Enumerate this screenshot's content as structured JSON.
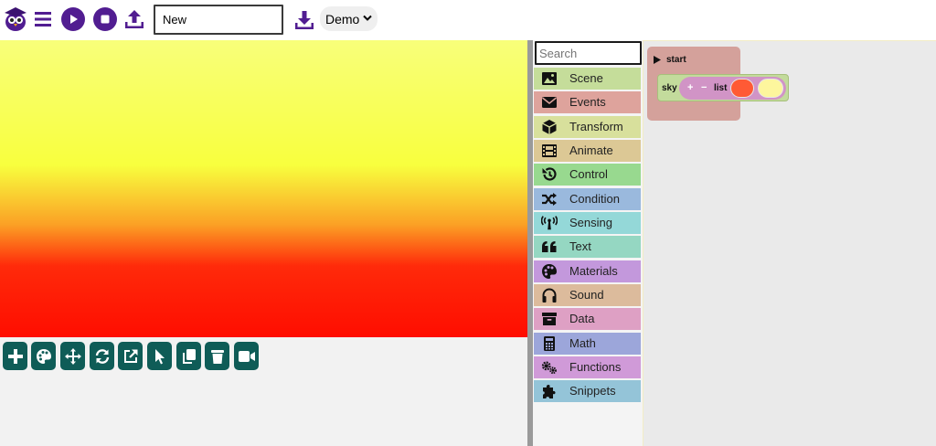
{
  "toolbar": {
    "project_name_value": "New",
    "demo_select_value": "Demo"
  },
  "colors": {
    "accent_purple": "#511d91",
    "tool_button": "#0f5c57",
    "sky_top": "#fdf69d",
    "sky_bottom": "#ff5a35"
  },
  "stage_tools": [
    {
      "icon": "plus-icon"
    },
    {
      "icon": "palette-icon"
    },
    {
      "icon": "move-icon"
    },
    {
      "icon": "rotate-icon"
    },
    {
      "icon": "external-link-icon"
    },
    {
      "icon": "pointer-icon"
    },
    {
      "icon": "copy-icon"
    },
    {
      "icon": "trash-icon"
    },
    {
      "icon": "video-camera-icon"
    }
  ],
  "toolbox": {
    "search_placeholder": "Search",
    "categories": [
      {
        "label": "Scene",
        "icon": "image-icon",
        "color": "#c5dd9a"
      },
      {
        "label": "Events",
        "icon": "envelope-icon",
        "color": "#dea39c"
      },
      {
        "label": "Transform",
        "icon": "cube-icon",
        "color": "#d8e09c"
      },
      {
        "label": "Animate",
        "icon": "film-icon",
        "color": "#dcc895"
      },
      {
        "label": "Control",
        "icon": "history-icon",
        "color": "#98d98f"
      },
      {
        "label": "Condition",
        "icon": "shuffle-icon",
        "color": "#9ab9dd"
      },
      {
        "label": "Sensing",
        "icon": "antenna-icon",
        "color": "#94d8d8"
      },
      {
        "label": "Text",
        "icon": "quote-icon",
        "color": "#95d7c2"
      },
      {
        "label": "Materials",
        "icon": "palette-icon",
        "color": "#c398dc"
      },
      {
        "label": "Sound",
        "icon": "headphones-icon",
        "color": "#dcbb9c"
      },
      {
        "label": "Data",
        "icon": "archive-icon",
        "color": "#dea0c4"
      },
      {
        "label": "Math",
        "icon": "calculator-icon",
        "color": "#9ca6da"
      },
      {
        "label": "Functions",
        "icon": "cogs-icon",
        "color": "#d09ad8"
      },
      {
        "label": "Snippets",
        "icon": "puzzle-icon",
        "color": "#94c4d8"
      }
    ]
  },
  "workspace": {
    "start_label": "start",
    "sky_label": "sky",
    "list_plus": "+",
    "list_minus": "−",
    "list_label": "list"
  }
}
